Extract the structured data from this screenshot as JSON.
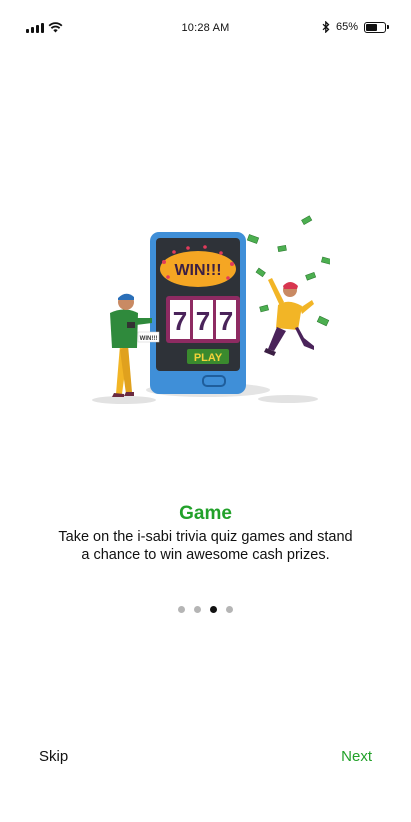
{
  "status_bar": {
    "time": "10:28 AM",
    "battery_percent": "65%",
    "battery_level": 0.65,
    "icons": [
      "signal-icon",
      "wifi-icon",
      "bluetooth-icon",
      "battery-icon"
    ]
  },
  "illustration": {
    "win_sign": "WIN!!!",
    "reels": [
      "7",
      "7",
      "7"
    ],
    "play_label": "PLAY",
    "card_text": "WIN!!!"
  },
  "onboarding": {
    "title": "Game",
    "description_line1": "Take on the i-sabi trivia quiz games and stand",
    "description_line2": "a chance to win awesome cash prizes.",
    "page_count": 4,
    "active_page_index": 2
  },
  "footer": {
    "skip_label": "Skip",
    "next_label": "Next"
  },
  "colors": {
    "accent": "#22a12a",
    "phone_blue": "#3f8fd8",
    "dot_inactive": "#b5b5b5",
    "dot_active": "#111111"
  }
}
